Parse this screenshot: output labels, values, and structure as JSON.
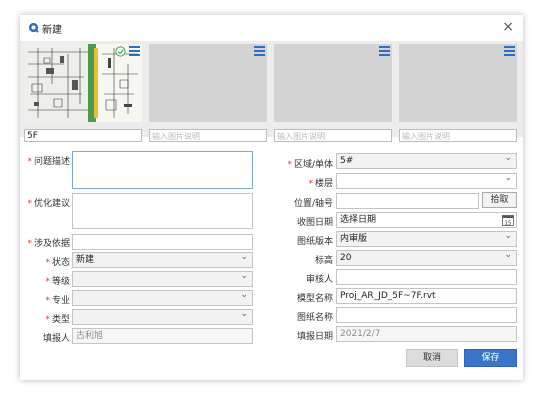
{
  "dialog": {
    "title": "新建",
    "close_symbol": "×"
  },
  "images": {
    "captions": [
      "5F",
      "",
      "",
      ""
    ],
    "placeholder": "输入图片说明"
  },
  "left_form": {
    "problem_label": "问题描述",
    "suggestion_label": "优化建议",
    "basis_label": "涉及依据",
    "status_label": "状态",
    "status_value": "新建",
    "level_label": "等级",
    "level_value": "",
    "discipline_label": "专业",
    "discipline_value": "",
    "type_label": "类型",
    "type_value": "",
    "reporter_label": "填报人",
    "reporter_value": "古利旭"
  },
  "right_form": {
    "zone_label": "区域/单体",
    "zone_value": "5#",
    "floor_label": "楼层",
    "floor_value": "",
    "position_label": "位置/轴号",
    "position_value": "",
    "pick_button": "拾取",
    "receive_date_label": "收图日期",
    "receive_date_value": "选择日期",
    "calendar_day": "15",
    "version_label": "图纸版本",
    "version_value": "内审版",
    "elevation_label": "标高",
    "elevation_value": "20",
    "reviewer_label": "审核人",
    "reviewer_value": "",
    "model_label": "模型名称",
    "model_value": "Proj_AR_JD_5F~7F.rvt",
    "drawing_label": "图纸名称",
    "drawing_value": "",
    "report_date_label": "填报日期",
    "report_date_value": "2021/2/7"
  },
  "footer": {
    "cancel": "取消",
    "save": "保存"
  },
  "colors": {
    "accent": "#3a74c6",
    "required": "#d9392b",
    "thumb_bg": "#d3d3d3"
  }
}
